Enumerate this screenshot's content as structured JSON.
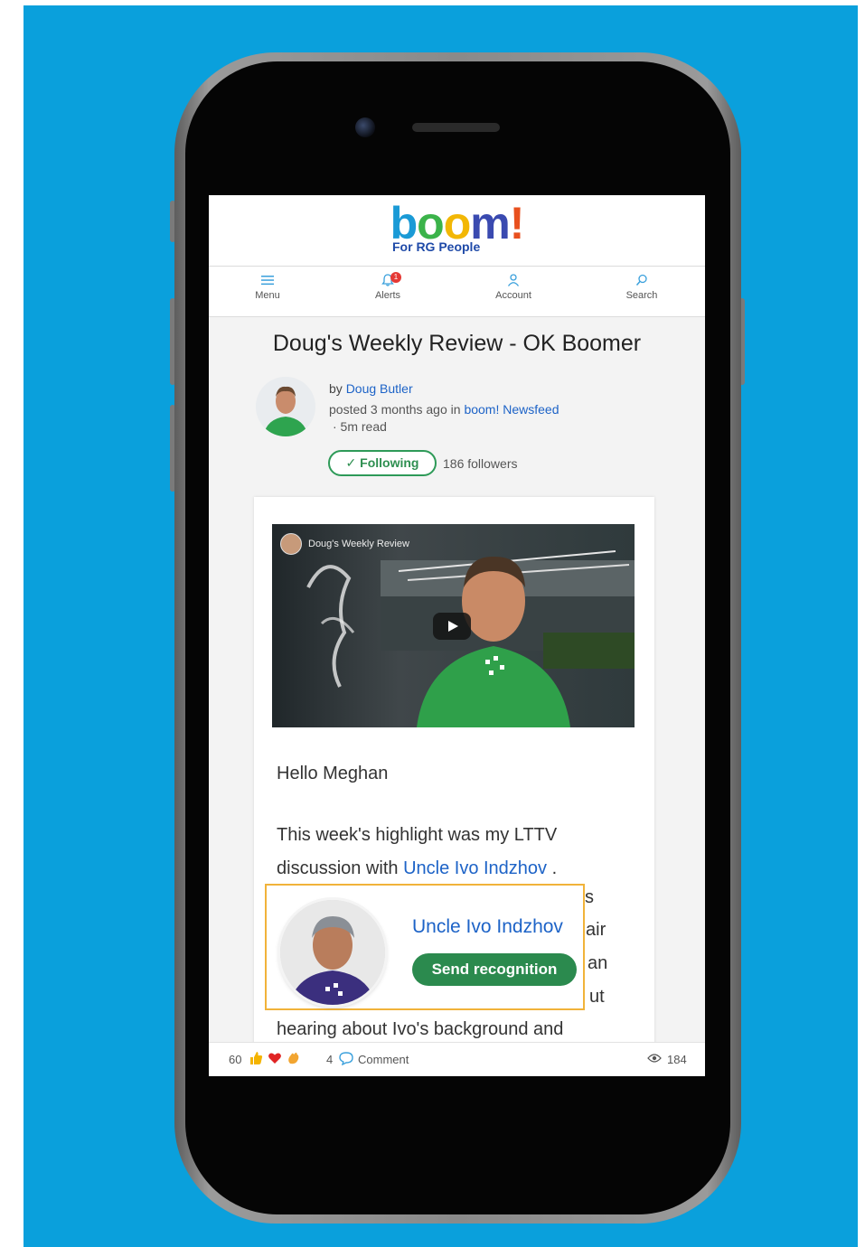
{
  "app": {
    "logo_text": "boom!",
    "logo_letters": [
      "b",
      "o",
      "o",
      "m",
      "!"
    ],
    "tagline": "For RG People",
    "colors": {
      "background": "#0aa0dc",
      "link": "#1d63c7",
      "green": "#2b8a4e",
      "highlight_border": "#f1b33a"
    }
  },
  "nav": {
    "items": [
      {
        "label": "Menu",
        "icon": "hamburger-icon"
      },
      {
        "label": "Alerts",
        "icon": "bell-icon",
        "badge": "1"
      },
      {
        "label": "Account",
        "icon": "person-icon"
      },
      {
        "label": "Search",
        "icon": "search-icon"
      }
    ]
  },
  "post": {
    "title": "Doug's Weekly Review - OK Boomer",
    "author_prefix": "by",
    "author": "Doug Butler",
    "posted_prefix": "posted 3 months ago in",
    "channel": "boom! Newsfeed",
    "read_time": "· 5m read",
    "follow_label": "Following",
    "followers": "186 followers",
    "video_title": "Doug's Weekly Review",
    "greeting": "Hello Meghan",
    "para_line1": "This week's highlight was my LTTV",
    "para_line2_prefix": "discussion with",
    "para_link": "Uncle Ivo Indzhov",
    "para_line2_suffix": ".",
    "frag_1": "s",
    "frag_2": "air",
    "frag_3": "an",
    "frag_4": "ut",
    "last_line": "hearing about Ivo's background and"
  },
  "popup": {
    "name": "Uncle Ivo Indzhov",
    "button": "Send recognition"
  },
  "footer": {
    "reactions_count": "60",
    "comments_count": "4",
    "comment_label": "Comment",
    "views": "184"
  }
}
